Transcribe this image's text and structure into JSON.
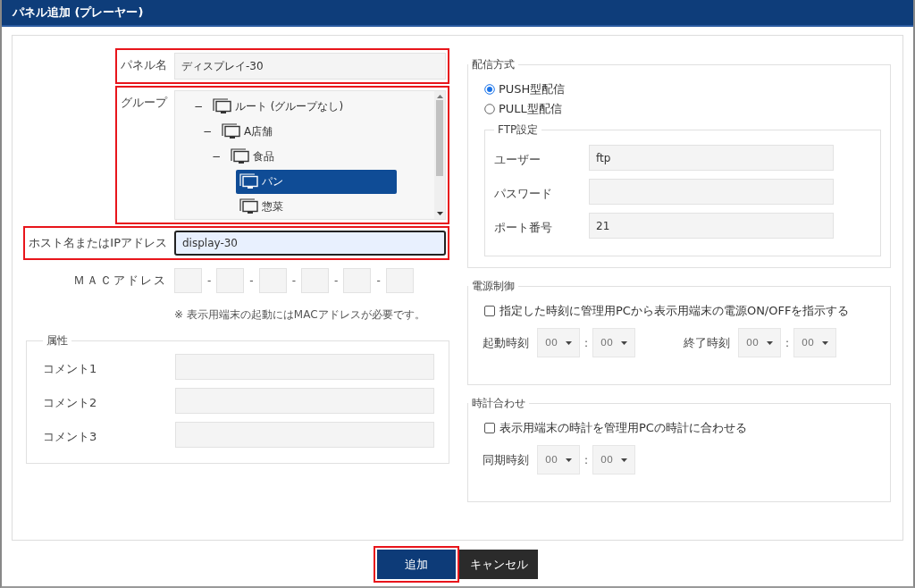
{
  "window": {
    "title": "パネル追加 (プレーヤー)"
  },
  "panel_name": {
    "label": "パネル名",
    "value": "ディスプレイ-30",
    "highlighted": true
  },
  "group": {
    "label": "グループ",
    "highlighted": true,
    "tree": [
      {
        "label": "ルート (グループなし)",
        "toggle": "−",
        "selected": false,
        "children": [
          {
            "label": "A店舗",
            "toggle": "−",
            "selected": false,
            "children": [
              {
                "label": "食品",
                "toggle": "−",
                "selected": false,
                "children": [
                  {
                    "label": "パン",
                    "selected": true
                  },
                  {
                    "label": "惣菜",
                    "selected": false
                  }
                ]
              }
            ]
          }
        ]
      }
    ]
  },
  "host": {
    "label": "ホスト名またはIPアドレス",
    "value": "display-30",
    "highlighted": true,
    "focused": true
  },
  "mac": {
    "label": "ＭＡＣアドレス",
    "separators": [
      "-",
      "-",
      "-",
      "-",
      "-"
    ],
    "note": "※ 表示用端末の起動にはMACアドレスが必要です。"
  },
  "attributes": {
    "legend": "属性",
    "fields": [
      {
        "label": "コメント1"
      },
      {
        "label": "コメント2"
      },
      {
        "label": "コメント3"
      }
    ]
  },
  "delivery": {
    "legend": "配信方式",
    "options": [
      {
        "label": "PUSH型配信",
        "selected": true
      },
      {
        "label": "PULL型配信",
        "selected": false
      }
    ],
    "ftp": {
      "legend": "FTP設定",
      "fields": [
        {
          "label": "ユーザー",
          "value": "ftp"
        },
        {
          "label": "パスワード"
        },
        {
          "label": "ポート番号",
          "value": "21"
        }
      ]
    }
  },
  "power": {
    "legend": "電源制御",
    "checkbox": {
      "label": "指定した時刻に管理用PCから表示用端末の電源ON/OFFを指示する",
      "checked": false
    },
    "times": [
      {
        "label": "起動時刻",
        "hour": "00",
        "separator": ":",
        "minute": "00"
      },
      {
        "label": "終了時刻",
        "hour": "00",
        "separator": ":",
        "minute": "00"
      }
    ]
  },
  "clock": {
    "legend": "時計合わせ",
    "checkbox": {
      "label": "表示用端末の時計を管理用PCの時計に合わせる",
      "checked": false
    },
    "times": [
      {
        "label": "同期時刻",
        "hour": "00",
        "separator": ":",
        "minute": "00"
      }
    ]
  },
  "buttons": [
    {
      "label": "追加",
      "kind": "primary",
      "highlighted": true
    },
    {
      "label": "キャンセル",
      "kind": "secondary",
      "highlighted": false
    }
  ]
}
